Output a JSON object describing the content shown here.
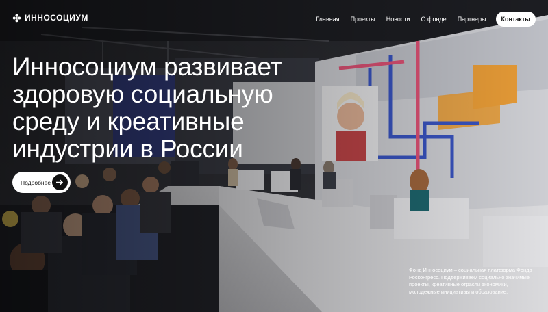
{
  "brand": {
    "name": "ИННОСОЦИУМ",
    "logo_icon": "asterisk-logo-icon"
  },
  "nav": {
    "items": [
      {
        "label": "Главная"
      },
      {
        "label": "Проекты"
      },
      {
        "label": "Новости"
      },
      {
        "label": "О фонде"
      },
      {
        "label": "Партнеры"
      }
    ],
    "cta_label": "Контакты"
  },
  "hero": {
    "title": "Инносоциум развивает здоровую социальную среду и креативные индустрии в России",
    "more_label": "Подробнее",
    "more_icon": "arrow-right-icon",
    "description": "Фонд Инносоциум – социальная платформа Фонда Росконгресс. Поддерживаем социально значимые проекты, креативные отрасли экономики, молодежные инициативы и образование."
  },
  "colors": {
    "accent": "#ffffff",
    "text_dark": "#111111",
    "screen_blue": "#3b57c9",
    "screen_orange": "#f2a33a"
  }
}
